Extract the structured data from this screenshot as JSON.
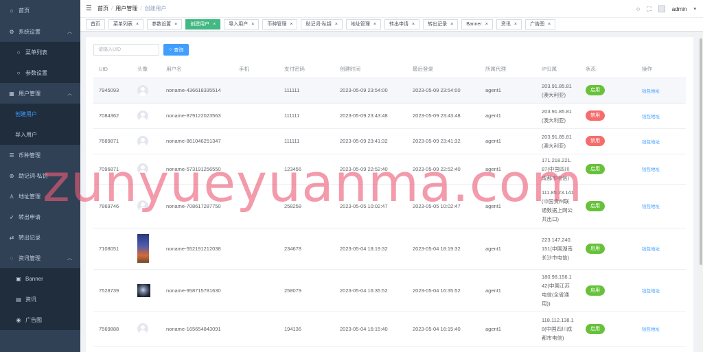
{
  "sidebar": {
    "home": "首页",
    "system": "系统设置",
    "menu_list": "菜单列表",
    "param_settings": "参数设置",
    "user_mgmt": "用户管理",
    "create_user": "创建用户",
    "import_user": "导入用户",
    "coin_mgmt": "币种管理",
    "mnemonic": "助记词-私钥",
    "address_mgmt": "地址管理",
    "withdraw_apply": "转出申请",
    "withdraw_record": "转出记录",
    "info_mgmt": "资讯管理",
    "banner": "Banner",
    "news": "资讯",
    "ads": "广告图"
  },
  "header": {
    "breadcrumb": [
      "首页",
      "用户管理",
      "创建用户"
    ],
    "user": "admin"
  },
  "tabs": [
    {
      "label": "首页",
      "closable": false,
      "active": false
    },
    {
      "label": "菜单列表",
      "closable": true,
      "active": false
    },
    {
      "label": "参数设置",
      "closable": true,
      "active": false
    },
    {
      "label": "创建用户",
      "closable": true,
      "active": true
    },
    {
      "label": "导入用户",
      "closable": true,
      "active": false
    },
    {
      "label": "币种管理",
      "closable": true,
      "active": false
    },
    {
      "label": "助记词-私钥",
      "closable": true,
      "active": false
    },
    {
      "label": "地址管理",
      "closable": true,
      "active": false
    },
    {
      "label": "转出申请",
      "closable": true,
      "active": false
    },
    {
      "label": "转出记录",
      "closable": true,
      "active": false
    },
    {
      "label": "Banner",
      "closable": true,
      "active": false
    },
    {
      "label": "资讯",
      "closable": true,
      "active": false
    },
    {
      "label": "广告图",
      "closable": true,
      "active": false
    }
  ],
  "search": {
    "placeholder": "请输入UID",
    "button": "查询"
  },
  "table": {
    "columns": [
      "UID",
      "头像",
      "用户名",
      "手机",
      "支付密码",
      "创建时间",
      "最后登录",
      "所属代理",
      "IP归属",
      "状态",
      "操作"
    ],
    "rows": [
      {
        "uid": "7945093",
        "avatar": "default",
        "username": "noname-436618335514",
        "phone": "",
        "pay_pwd": "111111",
        "created": "2023-05-09 23:54:00",
        "last_login": "2023-05-09 23:54:00",
        "agent": "agent1",
        "ip": [
          "203.91.85.81",
          "(澳大利亚)"
        ],
        "status": "启用",
        "status_color": "#67c23a",
        "action": "钱包地址"
      },
      {
        "uid": "7084362",
        "avatar": "default",
        "username": "noname-879122023563",
        "phone": "",
        "pay_pwd": "111111",
        "created": "2023-05-09 23:43:48",
        "last_login": "2023-05-09 23:43:48",
        "agent": "agent1",
        "ip": [
          "203.91.85.81",
          "(澳大利亚)"
        ],
        "status": "禁用",
        "status_color": "#f56c6c",
        "action": "钱包地址"
      },
      {
        "uid": "7689871",
        "avatar": "default",
        "username": "noname-861046251347",
        "phone": "",
        "pay_pwd": "111111",
        "created": "2023-05-09 23:41:32",
        "last_login": "2023-05-09 23:41:32",
        "agent": "agent1",
        "ip": [
          "203.91.85.81",
          "(澳大利亚)"
        ],
        "status": "禁用",
        "status_color": "#f56c6c",
        "action": "钱包地址"
      },
      {
        "uid": "7096871",
        "avatar": "default",
        "username": "noname-573191256550",
        "phone": "",
        "pay_pwd": "123456",
        "created": "2023-05-09 22:52:40",
        "last_login": "2023-05-09 22:52:40",
        "agent": "agent1",
        "ip": [
          "171.218.221.",
          "87(中国四川",
          "成都市电信)"
        ],
        "status": "启用",
        "status_color": "#67c23a",
        "action": "钱包地址"
      },
      {
        "uid": "7869746",
        "avatar": "default",
        "username": "noname-708617287750",
        "phone": "",
        "pay_pwd": "258258",
        "created": "2023-05-05 10:02:47",
        "last_login": "2023-05-05 10:02:47",
        "agent": "agent1",
        "ip": [
          "111.85.23.141",
          "(中国贵州联",
          "通数据上网公",
          "共出口)"
        ],
        "status": "启用",
        "status_color": "#67c23a",
        "action": "钱包地址"
      },
      {
        "uid": "7108051",
        "avatar": "photo-tall",
        "username": "noname-552191212038",
        "phone": "",
        "pay_pwd": "234678",
        "created": "2023-05-04 18:19:32",
        "last_login": "2023-05-04 18:19:32",
        "agent": "agent1",
        "ip": [
          "223.147.240.",
          "151(中国湖南",
          "长沙市电信)"
        ],
        "status": "启用",
        "status_color": "#67c23a",
        "action": "钱包地址"
      },
      {
        "uid": "7528739",
        "avatar": "photo-sq",
        "username": "noname-958715781630",
        "phone": "",
        "pay_pwd": "258079",
        "created": "2023-05-04 16:35:52",
        "last_login": "2023-05-04 16:35:52",
        "agent": "agent1",
        "ip": [
          "180.98.156.1",
          "42(中国江苏",
          "电信(全省通",
          "用))"
        ],
        "status": "启用",
        "status_color": "#67c23a",
        "action": "钱包地址"
      },
      {
        "uid": "7569888",
        "avatar": "default",
        "username": "noname-165654843091",
        "phone": "",
        "pay_pwd": "194136",
        "created": "2023-05-04 16:15:40",
        "last_login": "2023-05-04 16:15:40",
        "agent": "agent1",
        "ip": [
          "118.112.138.1",
          "8(中国四川成",
          "都市电信)"
        ],
        "status": "启用",
        "status_color": "#67c23a",
        "action": "钱包地址"
      }
    ]
  },
  "watermark": "zunyueyuanma.com"
}
